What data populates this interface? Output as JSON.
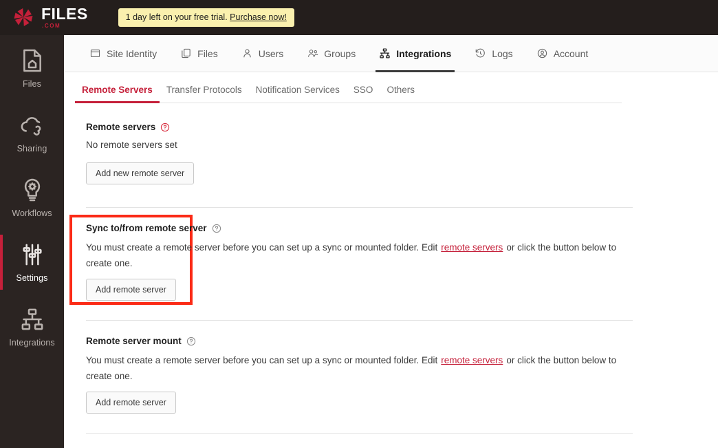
{
  "brand": {
    "name": "FILES",
    "suffix": ".COM",
    "logo_icon": "pinwheel-logo-icon",
    "accent_red": "#c5203a",
    "topbar_bg": "#241e1c",
    "sidebar_bg": "#2b2422"
  },
  "trial_banner": {
    "text": "1 day left on your free trial.",
    "link_label": "Purchase now!",
    "bg": "#faf0ae"
  },
  "sidebar": {
    "items": [
      {
        "label": "Files",
        "icon": "file-home-icon",
        "active": false
      },
      {
        "label": "Sharing",
        "icon": "cloud-link-icon",
        "active": false
      },
      {
        "label": "Workflows",
        "icon": "lightbulb-gear-icon",
        "active": false
      },
      {
        "label": "Settings",
        "icon": "sliders-icon",
        "active": true
      },
      {
        "label": "Integrations",
        "icon": "org-chart-icon",
        "active": false
      }
    ]
  },
  "tabs": [
    {
      "label": "Site Identity",
      "icon": "window-icon",
      "active": false
    },
    {
      "label": "Files",
      "icon": "copy-files-icon",
      "active": false
    },
    {
      "label": "Users",
      "icon": "user-icon",
      "active": false
    },
    {
      "label": "Groups",
      "icon": "users-group-icon",
      "active": false
    },
    {
      "label": "Integrations",
      "icon": "org-chart-icon",
      "active": true
    },
    {
      "label": "Logs",
      "icon": "history-clock-icon",
      "active": false
    },
    {
      "label": "Account",
      "icon": "account-circle-icon",
      "active": false
    }
  ],
  "subtabs": [
    {
      "label": "Remote Servers",
      "active": true
    },
    {
      "label": "Transfer Protocols",
      "active": false
    },
    {
      "label": "Notification Services",
      "active": false
    },
    {
      "label": "SSO",
      "active": false
    },
    {
      "label": "Others",
      "active": false
    }
  ],
  "sections": {
    "remote_servers": {
      "title": "Remote servers",
      "help_icon": "help-circle-icon",
      "empty_text": "No remote servers set",
      "button_label": "Add new remote server",
      "highlight_color": "#fb2a16"
    },
    "sync": {
      "title": "Sync to/from remote server",
      "help_icon": "help-circle-icon",
      "text_before_link": "You must create a remote server before you can set up a sync or mounted folder. Edit",
      "link_label": "remote servers",
      "text_after_link": "or click the button below to create one.",
      "button_label": "Add remote server"
    },
    "mount": {
      "title": "Remote server mount",
      "help_icon": "help-circle-icon",
      "text_before_link": "You must create a remote server before you can set up a sync or mounted folder. Edit",
      "link_label": "remote servers",
      "text_after_link": "or click the button below to create one.",
      "button_label": "Add remote server"
    }
  }
}
